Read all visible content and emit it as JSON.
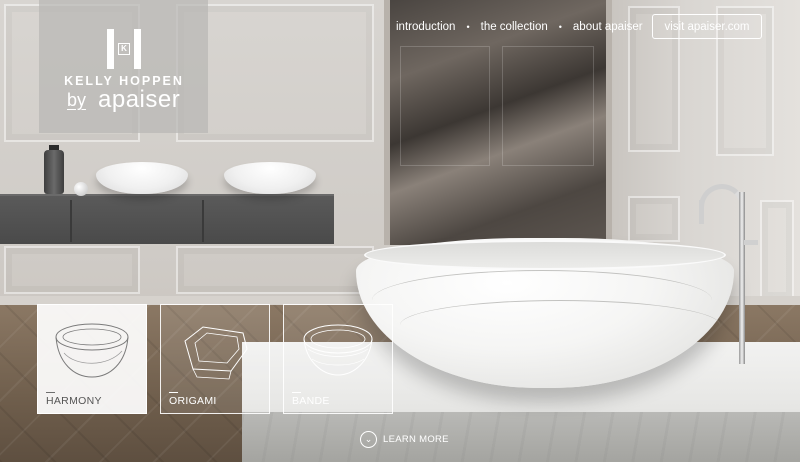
{
  "brand": {
    "name": "KELLY HOPPEN",
    "by": "by",
    "partner": "apaiser"
  },
  "nav": {
    "items": [
      {
        "label": "introduction"
      },
      {
        "label": "the collection"
      },
      {
        "label": "about apaiser"
      }
    ],
    "separator": "•",
    "cta": "visit apaiser.com"
  },
  "products": [
    {
      "label": "HARMONY",
      "selected": true
    },
    {
      "label": "ORIGAMI",
      "selected": false
    },
    {
      "label": "BANDE",
      "selected": false
    }
  ],
  "learn_more": {
    "label": "LEARN MORE",
    "icon": "chevron-down-icon"
  },
  "colors": {
    "logo_overlay": "#b9b7b4",
    "card_active": "#ffffff",
    "text": "#ffffff"
  }
}
